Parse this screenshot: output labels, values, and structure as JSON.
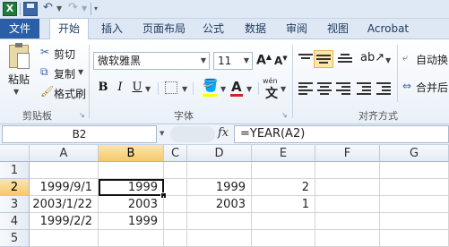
{
  "title_bar": {
    "app_icon_letter": "X",
    "undo_icon": "undo-icon",
    "redo_icon": "redo-icon"
  },
  "tabs": [
    "文件",
    "开始",
    "插入",
    "页面布局",
    "公式",
    "数据",
    "审阅",
    "视图",
    "Acrobat"
  ],
  "clipboard": {
    "cut": "剪切",
    "copy": "复制",
    "paste": "粘贴",
    "format_painter": "格式刷",
    "group_label": "剪贴板"
  },
  "font": {
    "name": "微软雅黑",
    "size": "11",
    "grow_label": "A",
    "shrink_label": "A",
    "bold": "B",
    "italic": "I",
    "underline": "U",
    "font_color_label": "A",
    "phonetic_label": "wén",
    "group_label": "字体"
  },
  "alignment": {
    "wrap_text": "自动换",
    "merge_center": "合并后",
    "group_label": "对齐方式"
  },
  "formula_bar": {
    "name_box": "B2",
    "fx": "fx",
    "formula": "=YEAR(A2)"
  },
  "columns": [
    "A",
    "B",
    "C",
    "D",
    "E",
    "F",
    "G"
  ],
  "rows": [
    {
      "num": "1",
      "cells": [
        "",
        "",
        "",
        "",
        "",
        "",
        ""
      ]
    },
    {
      "num": "2",
      "cells": [
        "1999/9/1",
        "1999",
        "",
        "1999",
        "2",
        "",
        ""
      ]
    },
    {
      "num": "3",
      "cells": [
        "2003/1/22",
        "2003",
        "",
        "2003",
        "1",
        "",
        ""
      ]
    },
    {
      "num": "4",
      "cells": [
        "1999/2/2",
        "1999",
        "",
        "",
        "",
        "",
        ""
      ]
    },
    {
      "num": "5",
      "cells": [
        "",
        "",
        "",
        "",
        "",
        "",
        ""
      ]
    }
  ],
  "active_cell": "B2",
  "colors": {
    "file_tab": "#2a5fa8",
    "excel_green": "#1e7b3c",
    "header_highlight": "#f6c96a",
    "font_color_red": "#d32222",
    "fill_yellow": "#ffff00"
  }
}
